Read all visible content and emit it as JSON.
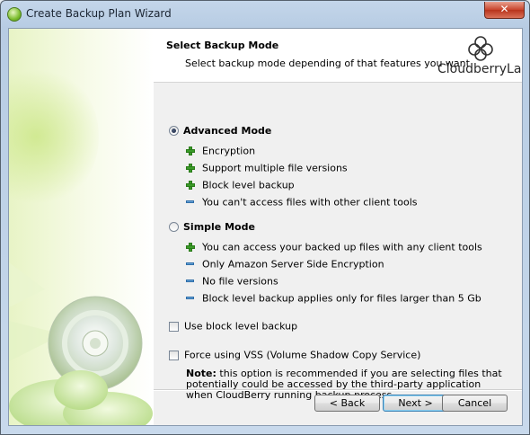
{
  "window": {
    "title": "Create Backup Plan Wizard",
    "close_glyph": "✕"
  },
  "header": {
    "title": "Select Backup Mode",
    "subtitle": "Select backup mode depending of that features you want",
    "logo_text": "CloudberryLab"
  },
  "modes": [
    {
      "label": "Advanced Mode",
      "selected": true,
      "features": [
        {
          "icon": "plus-icon",
          "text": "Encryption"
        },
        {
          "icon": "plus-icon",
          "text": "Support multiple file versions"
        },
        {
          "icon": "plus-icon",
          "text": "Block level backup"
        },
        {
          "icon": "minus-icon",
          "text": "You can't access files with other client tools"
        }
      ]
    },
    {
      "label": "Simple Mode",
      "selected": false,
      "features": [
        {
          "icon": "plus-icon",
          "text": "You can access your backed up files with any client tools"
        },
        {
          "icon": "minus-icon",
          "text": "Only Amazon Server Side Encryption"
        },
        {
          "icon": "minus-icon",
          "text": "No file versions"
        },
        {
          "icon": "minus-icon",
          "text": "Block level backup applies only for files larger than 5 Gb"
        }
      ]
    }
  ],
  "options": [
    {
      "label": "Use block level backup",
      "checked": false
    },
    {
      "label": "Force using VSS (Volume Shadow Copy Service)",
      "checked": false
    }
  ],
  "note": {
    "prefix": "Note:",
    "text": " this option is recommended if you are selecting files that potentially could be accessed by the third-party application when CloudBerry running backup process"
  },
  "buttons": {
    "back": "< Back",
    "next": "Next >",
    "cancel": "Cancel"
  },
  "colors": {
    "plus": "#3a9b28",
    "minus": "#3d87c9",
    "close": "#c8432b"
  }
}
